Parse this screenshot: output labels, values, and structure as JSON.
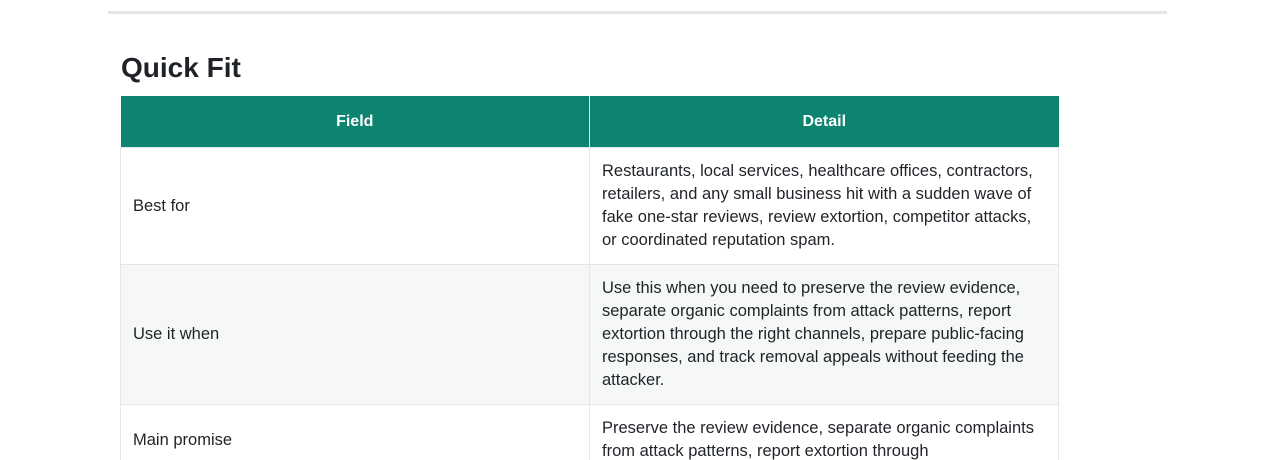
{
  "section": {
    "title": "Quick Fit"
  },
  "table": {
    "headers": [
      "Field",
      "Detail"
    ],
    "rows": [
      {
        "field": "Best for",
        "detail": "Restaurants, local services, healthcare offices, contractors, retailers, and any small business hit with a sudden wave of fake one-star reviews, review extortion, competitor attacks, or coordinated reputation spam."
      },
      {
        "field": "Use it when",
        "detail": "Use this when you need to preserve the review evidence, separate organic complaints from attack patterns, report extortion through the right channels, prepare public-facing responses, and track removal appeals without feeding the attacker."
      },
      {
        "field": "Main promise",
        "detail": "Preserve the review evidence, separate organic complaints from attack patterns, report extortion through"
      }
    ]
  },
  "colors": {
    "header_bg": "#0d8470",
    "header_text": "#ffffff",
    "alt_row_bg": "#f6f8f7",
    "border": "#e3e5e7"
  }
}
